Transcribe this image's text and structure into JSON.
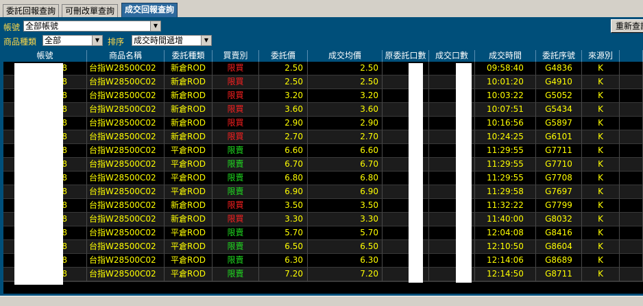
{
  "tabs": [
    {
      "label": "委託回報查詢",
      "active": false
    },
    {
      "label": "可刪改單查詢",
      "active": false
    },
    {
      "label": "成交回報查詢",
      "active": true
    }
  ],
  "filters": {
    "account_label": "帳號",
    "account_value": "全部帳號",
    "product_label": "商品種類",
    "product_value": "全部",
    "sort_label": "排序",
    "sort_value": "成交時間遞增",
    "refresh_label": "重新查詢"
  },
  "columns": [
    "帳號",
    "商品名稱",
    "委託種類",
    "買賣別",
    "委託價",
    "成交均價",
    "原委託口數",
    "成交口數",
    "成交時間",
    "委託序號",
    "來源別"
  ],
  "rows": [
    {
      "acct": "8",
      "name": "台指W28500C02",
      "type": "新倉ROD",
      "side": "限買",
      "side_kind": "buy",
      "price": "2.50",
      "avg": "2.50",
      "time": "09:58:40",
      "seq": "G4836",
      "src": "K"
    },
    {
      "acct": "8",
      "name": "台指W28500C02",
      "type": "新倉ROD",
      "side": "限買",
      "side_kind": "buy",
      "price": "2.50",
      "avg": "2.50",
      "time": "10:01:20",
      "seq": "G4910",
      "src": "K"
    },
    {
      "acct": "8",
      "name": "台指W28500C02",
      "type": "新倉ROD",
      "side": "限買",
      "side_kind": "buy",
      "price": "3.20",
      "avg": "3.20",
      "time": "10:03:22",
      "seq": "G5052",
      "src": "K"
    },
    {
      "acct": "8",
      "name": "台指W28500C02",
      "type": "新倉ROD",
      "side": "限買",
      "side_kind": "buy",
      "price": "3.60",
      "avg": "3.60",
      "time": "10:07:51",
      "seq": "G5434",
      "src": "K"
    },
    {
      "acct": "8",
      "name": "台指W28500C02",
      "type": "新倉ROD",
      "side": "限買",
      "side_kind": "buy",
      "price": "2.90",
      "avg": "2.90",
      "time": "10:16:56",
      "seq": "G5897",
      "src": "K"
    },
    {
      "acct": "8",
      "name": "台指W28500C02",
      "type": "新倉ROD",
      "side": "限買",
      "side_kind": "buy",
      "price": "2.70",
      "avg": "2.70",
      "time": "10:24:25",
      "seq": "G6101",
      "src": "K"
    },
    {
      "acct": "8",
      "name": "台指W28500C02",
      "type": "平倉ROD",
      "side": "限賣",
      "side_kind": "sell",
      "price": "6.60",
      "avg": "6.60",
      "time": "11:29:55",
      "seq": "G7711",
      "src": "K"
    },
    {
      "acct": "8",
      "name": "台指W28500C02",
      "type": "平倉ROD",
      "side": "限賣",
      "side_kind": "sell",
      "price": "6.70",
      "avg": "6.70",
      "time": "11:29:55",
      "seq": "G7710",
      "src": "K"
    },
    {
      "acct": "8",
      "name": "台指W28500C02",
      "type": "平倉ROD",
      "side": "限賣",
      "side_kind": "sell",
      "price": "6.80",
      "avg": "6.80",
      "time": "11:29:55",
      "seq": "G7708",
      "src": "K"
    },
    {
      "acct": "8",
      "name": "台指W28500C02",
      "type": "平倉ROD",
      "side": "限賣",
      "side_kind": "sell",
      "price": "6.90",
      "avg": "6.90",
      "time": "11:29:58",
      "seq": "G7697",
      "src": "K"
    },
    {
      "acct": "8",
      "name": "台指W28500C02",
      "type": "新倉ROD",
      "side": "限買",
      "side_kind": "buy",
      "price": "3.50",
      "avg": "3.50",
      "time": "11:32:22",
      "seq": "G7799",
      "src": "K"
    },
    {
      "acct": "8",
      "name": "台指W28500C02",
      "type": "新倉ROD",
      "side": "限買",
      "side_kind": "buy",
      "price": "3.30",
      "avg": "3.30",
      "time": "11:40:00",
      "seq": "G8032",
      "src": "K"
    },
    {
      "acct": "8",
      "name": "台指W28500C02",
      "type": "平倉ROD",
      "side": "限賣",
      "side_kind": "sell",
      "price": "5.70",
      "avg": "5.70",
      "time": "12:04:08",
      "seq": "G8416",
      "src": "K"
    },
    {
      "acct": "8",
      "name": "台指W28500C02",
      "type": "平倉ROD",
      "side": "限賣",
      "side_kind": "sell",
      "price": "6.50",
      "avg": "6.50",
      "time": "12:10:50",
      "seq": "G8604",
      "src": "K"
    },
    {
      "acct": "8",
      "name": "台指W28500C02",
      "type": "平倉ROD",
      "side": "限賣",
      "side_kind": "sell",
      "price": "6.30",
      "avg": "6.30",
      "time": "12:14:06",
      "seq": "G8689",
      "src": "K"
    },
    {
      "acct": "8",
      "name": "台指W28500C02",
      "type": "平倉ROD",
      "side": "限賣",
      "side_kind": "sell",
      "price": "7.20",
      "avg": "7.20",
      "time": "12:14:50",
      "seq": "G8711",
      "src": "K"
    }
  ],
  "colors": {
    "buy": "#ff2020",
    "sell": "#20e020",
    "cell_text": "#ffff00",
    "panel_bg": "#004f7a"
  },
  "icons": {
    "dropdown": "chevron-down-icon"
  }
}
